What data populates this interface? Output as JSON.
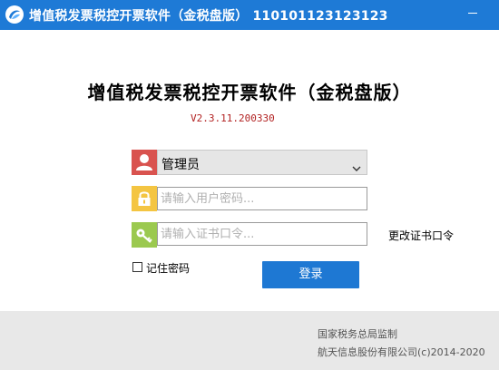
{
  "window": {
    "title": "增值税发票税控开票软件（金税盘版） 110101123123123",
    "icon": "app-logo-icon",
    "minimize_icon": "minimize-icon"
  },
  "main": {
    "heading": "增值税发票税控开票软件（金税盘版）",
    "version": "V2.3.11.200330"
  },
  "login_form": {
    "user_select": {
      "icon": "user-icon",
      "value": "管理员",
      "chevron_icon": "chevron-down-icon"
    },
    "password": {
      "icon": "lock-icon",
      "placeholder": "请输入用户密码..."
    },
    "certificate": {
      "icon": "key-icon",
      "placeholder": "请输入证书口令..."
    },
    "change_cert_link": "更改证书口令",
    "remember_label": "记住密码",
    "login_button": "登录"
  },
  "footer": {
    "supervision": "国家税务总局监制",
    "copyright": "航天信息股份有限公司(c)2014-2020"
  },
  "colors": {
    "titlebar": "#1e7ad6",
    "user_icon_bg": "#d9534f",
    "lock_icon_bg": "#f4c542",
    "key_icon_bg": "#9bc94f",
    "version_text": "#b22222",
    "login_button": "#1e78d3",
    "footer_bg": "#e8e8e8"
  }
}
